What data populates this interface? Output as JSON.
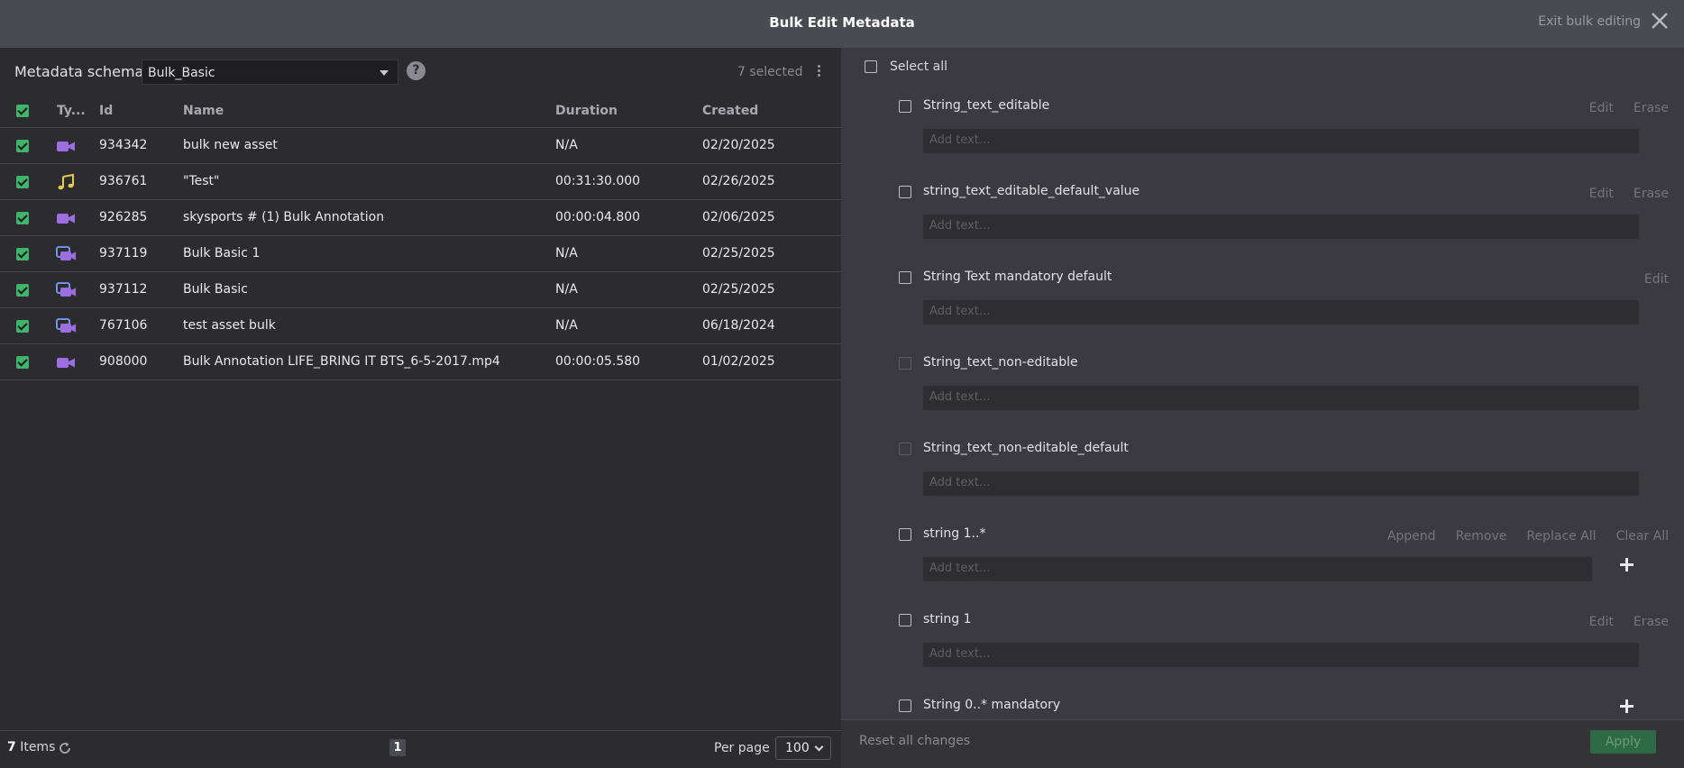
{
  "header": {
    "title": "Bulk Edit Metadata",
    "exit_label": "Exit bulk editing"
  },
  "left": {
    "schema_label": "Metadata schema:",
    "schema_value": "Bulk_Basic",
    "help": "?",
    "selected": "7 selected",
    "columns": {
      "type": "Ty...",
      "id": "Id",
      "name": "Name",
      "duration": "Duration",
      "created": "Created"
    },
    "rows": [
      {
        "type": "video",
        "id": "934342",
        "name": "bulk new asset",
        "duration": "N/A",
        "created": "02/20/2025"
      },
      {
        "type": "audio",
        "id": "936761",
        "name": "\"Test\"",
        "duration": "00:31:30.000",
        "created": "02/26/2025"
      },
      {
        "type": "video",
        "id": "926285",
        "name": "skysports # (1) Bulk Annotation",
        "duration": "00:00:04.800",
        "created": "02/06/2025"
      },
      {
        "type": "collection",
        "id": "937119",
        "name": "Bulk Basic 1",
        "duration": "N/A",
        "created": "02/25/2025"
      },
      {
        "type": "collection",
        "id": "937112",
        "name": "Bulk Basic",
        "duration": "N/A",
        "created": "02/25/2025"
      },
      {
        "type": "collection",
        "id": "767106",
        "name": "test asset bulk",
        "duration": "N/A",
        "created": "06/18/2024"
      },
      {
        "type": "video",
        "id": "908000",
        "name": "Bulk Annotation LIFE_BRING IT BTS_6-5-2017.mp4",
        "duration": "00:00:05.580",
        "created": "01/02/2025"
      }
    ],
    "footer": {
      "items_count": "7",
      "items_label": " Items",
      "page": "1",
      "per_page_label": "Per page",
      "per_page_value": "100"
    }
  },
  "right": {
    "select_all": "Select all",
    "placeholder": "Add text...",
    "fields": [
      {
        "name": "String_text_editable",
        "actions": [
          "Edit",
          "Erase"
        ],
        "disabled": false,
        "plus": false
      },
      {
        "name": "string_text_editable_default_value",
        "actions": [
          "Edit",
          "Erase"
        ],
        "disabled": false,
        "plus": false
      },
      {
        "name": "String Text mandatory default",
        "actions": [
          "Edit"
        ],
        "disabled": false,
        "plus": false
      },
      {
        "name": "String_text_non-editable",
        "actions": [],
        "disabled": true,
        "plus": false
      },
      {
        "name": "String_text_non-editable_default",
        "actions": [],
        "disabled": true,
        "plus": false
      },
      {
        "name": "string 1..*",
        "actions": [
          "Append",
          "Remove",
          "Replace All",
          "Clear All"
        ],
        "disabled": false,
        "plus": true
      },
      {
        "name": "string 1",
        "actions": [
          "Edit",
          "Erase"
        ],
        "disabled": false,
        "plus": false
      },
      {
        "name": "String 0..* mandatory",
        "actions": [],
        "disabled": false,
        "plus": true
      }
    ],
    "reset_label": "Reset all changes",
    "apply_label": "Apply"
  },
  "colors": {
    "checkbox_checked": "#3fb46a",
    "video_icon": "#9b6fe0",
    "audio_icon": "#e6c84a",
    "collection_icon": "#7aa0f0",
    "apply_button": "#2f6a47"
  }
}
